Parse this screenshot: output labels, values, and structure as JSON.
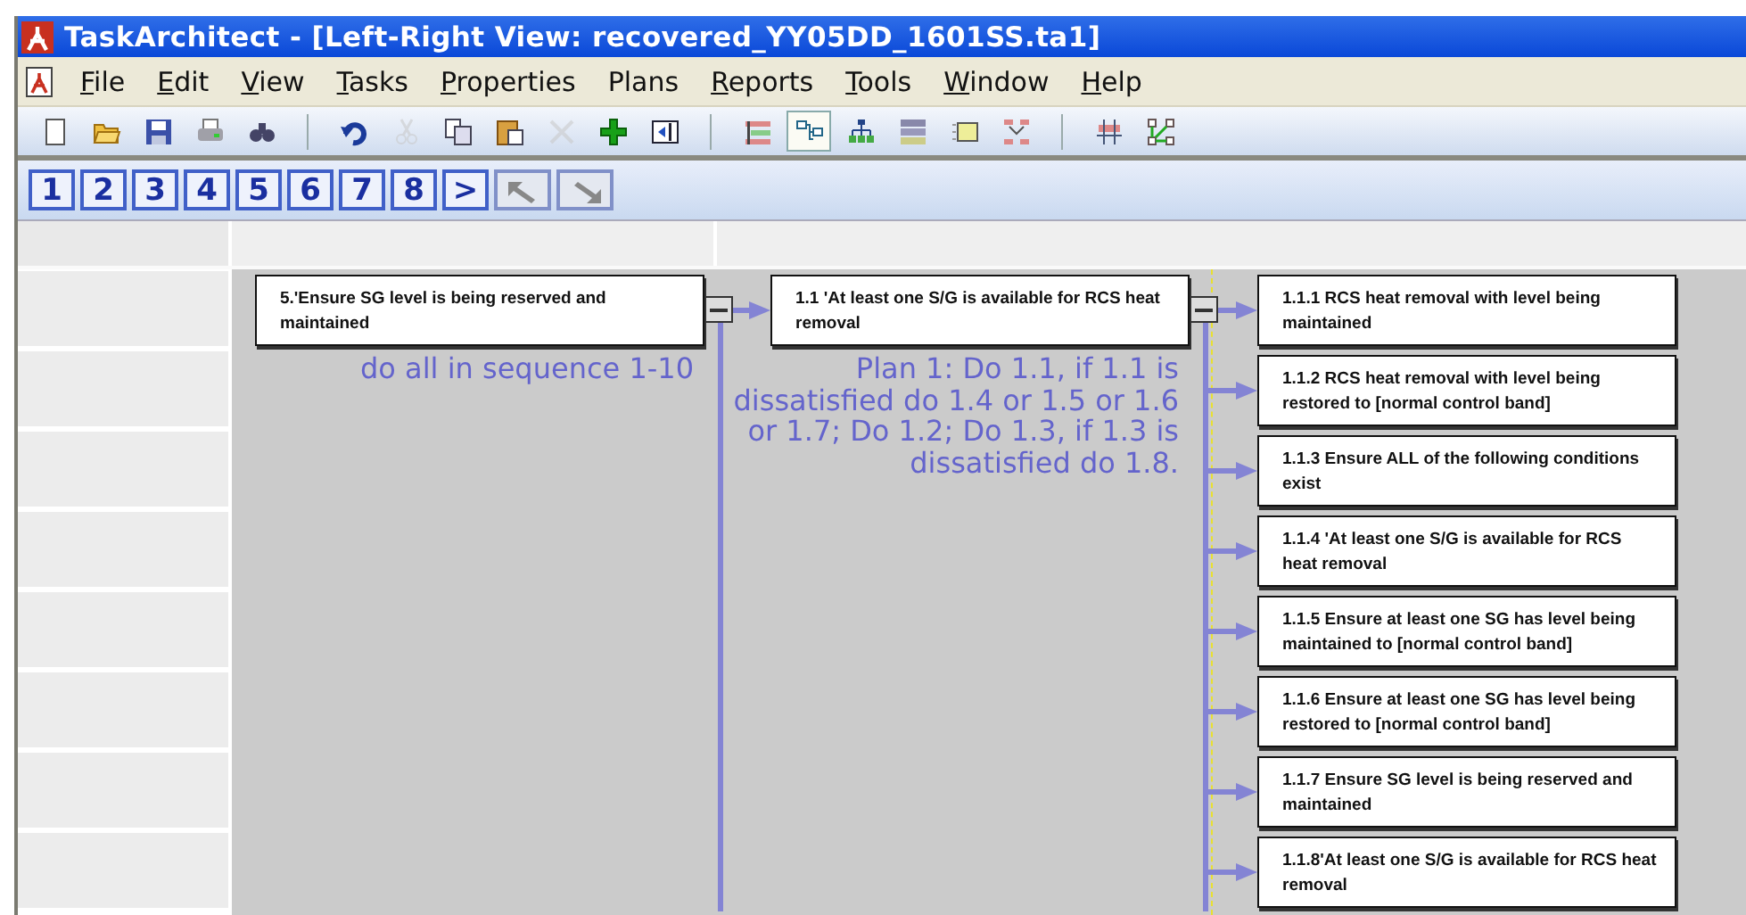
{
  "window": {
    "title": "TaskArchitect - [Left-Right View: recovered_YY05DD_1601SS.ta1]"
  },
  "menu": [
    {
      "label": "File",
      "mnemonic": true
    },
    {
      "label": "Edit",
      "mnemonic": true
    },
    {
      "label": "View",
      "mnemonic": true
    },
    {
      "label": "Tasks",
      "mnemonic": true
    },
    {
      "label": "Properties",
      "mnemonic": true
    },
    {
      "label": "Plans",
      "mnemonic": false
    },
    {
      "label": "Reports",
      "mnemonic": true
    },
    {
      "label": "Tools",
      "mnemonic": true
    },
    {
      "label": "Window",
      "mnemonic": true
    },
    {
      "label": "Help",
      "mnemonic": true
    }
  ],
  "toolbar": [
    {
      "kind": "new",
      "disabled": false,
      "selected": false
    },
    {
      "kind": "open",
      "disabled": false,
      "selected": false
    },
    {
      "kind": "save",
      "disabled": false,
      "selected": false
    },
    {
      "kind": "print",
      "disabled": false,
      "selected": false
    },
    {
      "kind": "find",
      "disabled": false,
      "selected": false
    },
    {
      "kind": "separator"
    },
    {
      "kind": "undo",
      "disabled": false,
      "selected": false
    },
    {
      "kind": "cut",
      "disabled": true,
      "selected": false
    },
    {
      "kind": "copy",
      "disabled": false,
      "selected": false
    },
    {
      "kind": "paste",
      "disabled": false,
      "selected": false
    },
    {
      "kind": "delete",
      "disabled": true,
      "selected": false
    },
    {
      "kind": "add",
      "disabled": false,
      "selected": false
    },
    {
      "kind": "panel",
      "disabled": false,
      "selected": false
    },
    {
      "kind": "separator"
    },
    {
      "kind": "bars",
      "disabled": false,
      "selected": false
    },
    {
      "kind": "left-right",
      "disabled": false,
      "selected": true
    },
    {
      "kind": "tree",
      "disabled": false,
      "selected": false
    },
    {
      "kind": "grid",
      "disabled": false,
      "selected": false
    },
    {
      "kind": "list",
      "disabled": false,
      "selected": false
    },
    {
      "kind": "flow",
      "disabled": false,
      "selected": false
    },
    {
      "kind": "separator"
    },
    {
      "kind": "table",
      "disabled": false,
      "selected": false
    },
    {
      "kind": "links",
      "disabled": false,
      "selected": false
    }
  ],
  "levels": [
    {
      "label": "1"
    },
    {
      "label": "2"
    },
    {
      "label": "3"
    },
    {
      "label": "4"
    },
    {
      "label": "5"
    },
    {
      "label": "6"
    },
    {
      "label": "7"
    },
    {
      "label": "8"
    },
    {
      "label": ">"
    }
  ],
  "nav_buttons": [
    {
      "kind": "up-left"
    },
    {
      "kind": "down-right"
    }
  ],
  "tree": {
    "text": "5.'Ensure SG level is being reserved and maintained",
    "expanded": true,
    "plan": "do all in sequence 1-10",
    "children": [
      {
        "text": "1.1 'At least one S/G is available  for RCS heat removal",
        "expanded": true,
        "plan": "Plan 1: Do 1.1, if 1.1 is dissatisfied do 1.4 or 1.5 or 1.6 or 1.7; Do 1.2; Do 1.3, if 1.3 is dissatisfied do 1.8.",
        "children": [
          {
            "text": "1.1.1 RCS heat removal  with level being maintained"
          },
          {
            "text": "1.1.2 RCS heat removal  with level being restored to [normal  control band]"
          },
          {
            "text": "1.1.3 Ensure ALL of the following conditions exist"
          },
          {
            "text": "1.1.4 'At least one S/G is available  for RCS heat removal"
          },
          {
            "text": "1.1.5 Ensure at least one SG has level being maintained to [normal control band]"
          },
          {
            "text": "1.1.6 Ensure at least one SG has level being restored to [normal control band]"
          },
          {
            "text": "1.1.7 Ensure SG level is being reserved and maintained"
          },
          {
            "text": "1.1.8'At least one S/G is available  for RCS heat removal"
          }
        ]
      }
    ]
  }
}
